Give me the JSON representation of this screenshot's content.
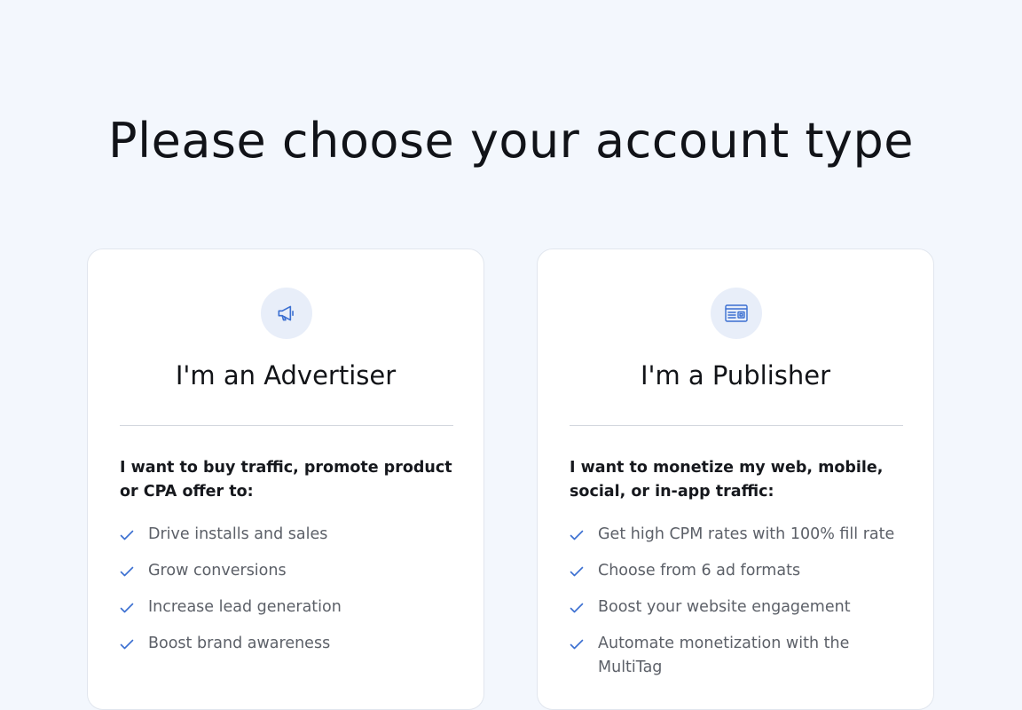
{
  "page": {
    "title": "Please choose your account type"
  },
  "advertiser": {
    "icon": "megaphone-icon",
    "title": "I'm an Advertiser",
    "lead": "I want to buy traffic, promote product or CPA offer to:",
    "features": [
      "Drive installs and sales",
      "Grow conversions",
      "Increase lead generation",
      "Boost brand awareness"
    ]
  },
  "publisher": {
    "icon": "browser-window-icon",
    "title": "I'm a Publisher",
    "lead": "I want to monetize my web, mobile, social, or in-app traffic:",
    "features": [
      "Get high CPM rates with 100% fill rate",
      "Choose from 6 ad formats",
      "Boost your website engagement",
      "Automate monetization with the MultiTag"
    ]
  },
  "colors": {
    "background": "#f3f7fd",
    "card": "#ffffff",
    "accent": "#3b6fd1",
    "icon_circle": "#e8eef9",
    "muted_text": "#5c6068"
  }
}
